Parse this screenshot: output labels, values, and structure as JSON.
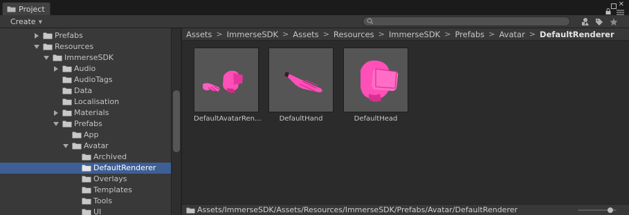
{
  "window": {
    "tab_title": "Project"
  },
  "toolbar": {
    "create_label": "Create",
    "search_placeholder": ""
  },
  "tree": {
    "items": [
      {
        "label": "Prefabs",
        "depth": 3,
        "state": "collapsed",
        "selected": false
      },
      {
        "label": "Resources",
        "depth": 3,
        "state": "expanded",
        "selected": false
      },
      {
        "label": "ImmerseSDK",
        "depth": 4,
        "state": "expanded",
        "selected": false
      },
      {
        "label": "Audio",
        "depth": 5,
        "state": "collapsed",
        "selected": false
      },
      {
        "label": "AudioTags",
        "depth": 5,
        "state": "none",
        "selected": false
      },
      {
        "label": "Data",
        "depth": 5,
        "state": "none",
        "selected": false
      },
      {
        "label": "Localisation",
        "depth": 5,
        "state": "none",
        "selected": false
      },
      {
        "label": "Materials",
        "depth": 5,
        "state": "collapsed",
        "selected": false
      },
      {
        "label": "Prefabs",
        "depth": 5,
        "state": "expanded",
        "selected": false
      },
      {
        "label": "App",
        "depth": 6,
        "state": "none",
        "selected": false
      },
      {
        "label": "Avatar",
        "depth": 6,
        "state": "expanded",
        "selected": false
      },
      {
        "label": "Archived",
        "depth": 7,
        "state": "none",
        "selected": false
      },
      {
        "label": "DefaultRenderer",
        "depth": 7,
        "state": "none",
        "selected": true
      },
      {
        "label": "Overlays",
        "depth": 7,
        "state": "none",
        "selected": false
      },
      {
        "label": "Templates",
        "depth": 7,
        "state": "none",
        "selected": false
      },
      {
        "label": "Tools",
        "depth": 7,
        "state": "none",
        "selected": false
      },
      {
        "label": "UI",
        "depth": 7,
        "state": "none",
        "selected": false
      }
    ]
  },
  "breadcrumb": [
    "Assets",
    "ImmerseSDK",
    "Assets",
    "Resources",
    "ImmerseSDK",
    "Prefabs",
    "Avatar",
    "DefaultRenderer"
  ],
  "assets": [
    {
      "label": "DefaultAvatarRen...",
      "icon": "avatar-head-and-hand-preview"
    },
    {
      "label": "DefaultHand",
      "icon": "hand-preview"
    },
    {
      "label": "DefaultHead",
      "icon": "head-preview"
    }
  ],
  "status": {
    "path": "Assets/ImmerseSDK/Assets/Resources/ImmerseSDK/Prefabs/Avatar/DefaultRenderer",
    "zoom_level": 0.9
  },
  "colors": {
    "selection": "#3e5f96",
    "asset_pink": "#ff4fb8",
    "folder": "#c8c8c8"
  }
}
